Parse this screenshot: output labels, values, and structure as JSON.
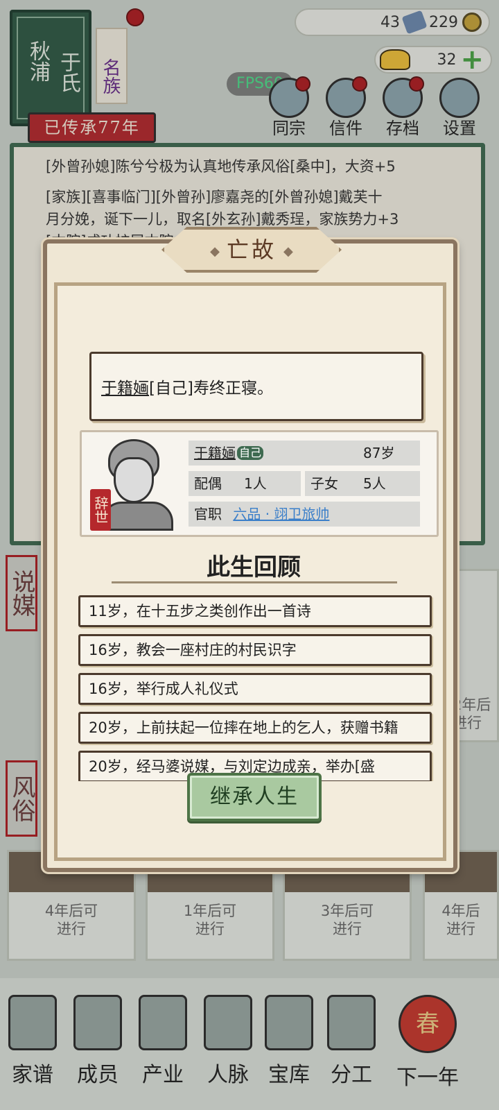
{
  "clan": {
    "surname_1": "秋浦",
    "surname_2": "于氏",
    "tag": "名族",
    "years": "已传承77年"
  },
  "resources": {
    "ticket_count": "43",
    "coin_count": "229",
    "gold_count": "32"
  },
  "fps": "FPS60",
  "top_menu": [
    {
      "label": "同宗",
      "icon": "clan-book-icon"
    },
    {
      "label": "信件",
      "icon": "letters-icon"
    },
    {
      "label": "存档",
      "icon": "save-icon"
    },
    {
      "label": "设置",
      "icon": "gear-icon"
    }
  ],
  "log": {
    "line1": "[外曾孙媳]陈兮兮极为认真地传承风俗[桑中]，大资+5",
    "line2": "[家族][喜事临门][外曾孙]廖嘉尧的[外曾孙媳]戴芙十",
    "line3": "月分娩，诞下一儿，取名[外玄孙]戴秀珵，家族势力+3",
    "line4": "[本院]成功扩展本院，练习[大漠]驱妖"
  },
  "side_tabs": {
    "matchmaking": "说媒",
    "customs": "风俗"
  },
  "cards": [
    {
      "line1": "4年后可",
      "line2": "进行"
    },
    {
      "line1": "1年后可",
      "line2": "进行"
    },
    {
      "line1": "3年后可",
      "line2": "进行"
    },
    {
      "line1": "4年后",
      "line2": "进行"
    }
  ],
  "side_card": {
    "line1": "2年后",
    "line2": "进行"
  },
  "bottom_nav": [
    {
      "label": "家谱",
      "icon": "genealogy-icon"
    },
    {
      "label": "成员",
      "icon": "member-icon"
    },
    {
      "label": "产业",
      "icon": "industry-icon"
    },
    {
      "label": "人脉",
      "icon": "network-icon"
    },
    {
      "label": "宝库",
      "icon": "treasury-icon"
    },
    {
      "label": "分工",
      "icon": "division-icon"
    },
    {
      "label": "下一年",
      "icon": "next-year-icon",
      "badge": "春"
    }
  ],
  "modal": {
    "title": "亡故",
    "message_name": "于籍婳",
    "message_rest": "[自己]寿终正寝。",
    "profile": {
      "stamp": "辞世",
      "name": "于籍婳",
      "self_badge": "自己",
      "age": "87岁",
      "spouse_label": "配偶",
      "spouse_value": "1人",
      "children_label": "子女",
      "children_value": "5人",
      "office_label": "官职",
      "office_value": "六品 · 翊卫旅帅"
    },
    "review_title": "此生回顾",
    "life_events": [
      "11岁，在十五步之类创作出一首诗",
      "16岁，教会一座村庄的村民识字",
      "16岁，举行成人礼仪式",
      "20岁，上前扶起一位摔在地上的乞人，获赠书籍",
      "20岁，经马婆说媒，与刘定边成亲，举办[盛"
    ],
    "inherit_button": "继承人生"
  },
  "colors": {
    "panel_green": "#3e6a50",
    "seal_red": "#b5282c",
    "link_blue": "#3b7fc9",
    "button_green": "#a9c9a0"
  }
}
